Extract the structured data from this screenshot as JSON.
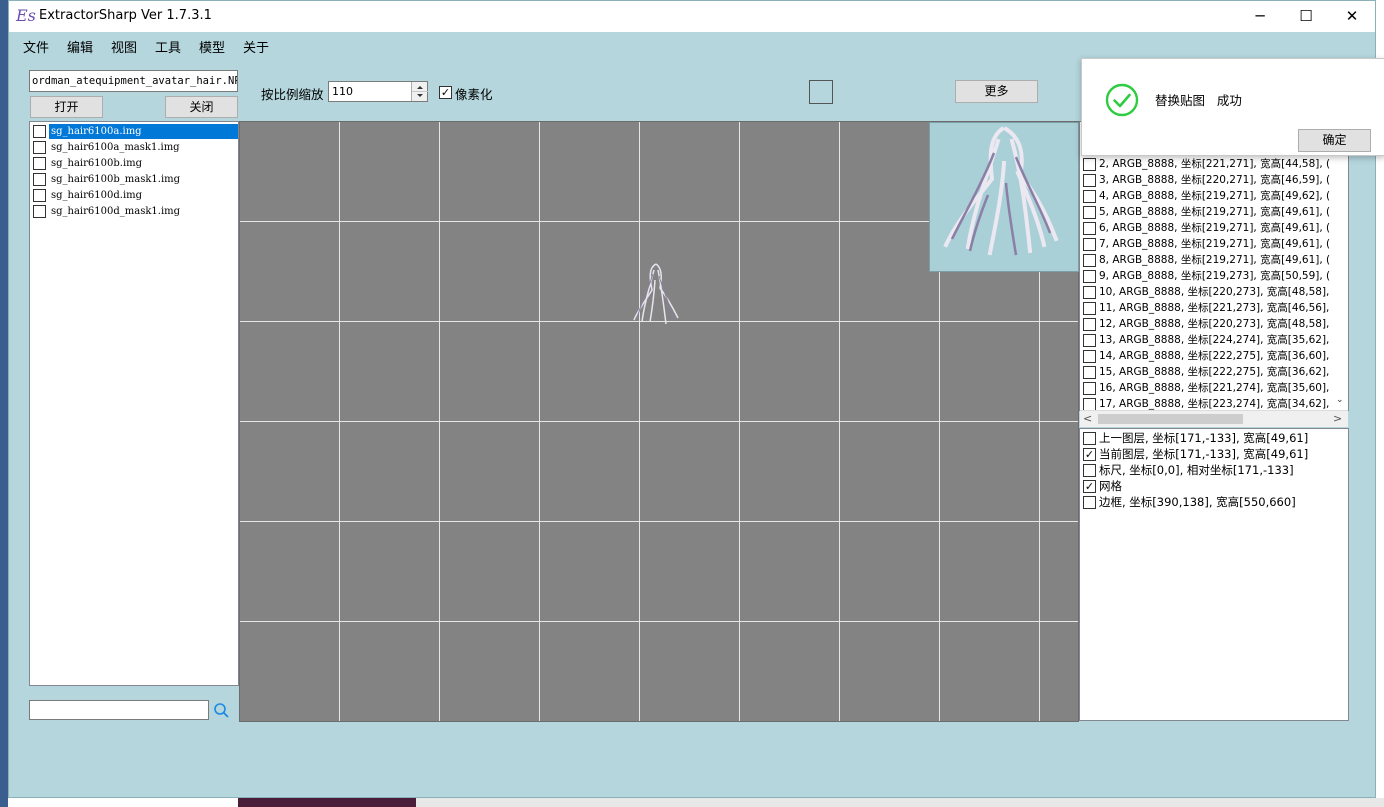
{
  "window": {
    "title": "ExtractorSharp Ver 1.7.3.1",
    "icon_text": "Es",
    "controls": {
      "minimize": "─",
      "maximize": "☐",
      "close": "✕"
    }
  },
  "menu": [
    "文件",
    "编辑",
    "视图",
    "工具",
    "模型",
    "关于"
  ],
  "left_panel": {
    "file_path": "ordman_atequipment_avatar_hair.NPK",
    "open_label": "打开",
    "close_label": "关闭",
    "files": [
      {
        "name": "sg_hair6100a.img",
        "selected": true
      },
      {
        "name": "sg_hair6100a_mask1.img",
        "selected": false
      },
      {
        "name": "sg_hair6100b.img",
        "selected": false
      },
      {
        "name": "sg_hair6100b_mask1.img",
        "selected": false
      },
      {
        "name": "sg_hair6100d.img",
        "selected": false
      },
      {
        "name": "sg_hair6100d_mask1.img",
        "selected": false
      }
    ],
    "search_value": ""
  },
  "toolbar": {
    "zoom_label": "按比例缩放",
    "zoom_value": "110",
    "pixelate_label": "像素化",
    "pixelate_checked": true,
    "more_label": "更多"
  },
  "layers": [
    "2, ARGB_8888, 坐标[221,271], 宽高[44,58], (",
    "3, ARGB_8888, 坐标[220,271], 宽高[46,59], (",
    "4, ARGB_8888, 坐标[219,271], 宽高[49,62], (",
    "5, ARGB_8888, 坐标[219,271], 宽高[49,61], (",
    "6, ARGB_8888, 坐标[219,271], 宽高[49,61], (",
    "7, ARGB_8888, 坐标[219,271], 宽高[49,61], (",
    "8, ARGB_8888, 坐标[219,271], 宽高[49,61], (",
    "9, ARGB_8888, 坐标[219,273], 宽高[50,59], (",
    "10, ARGB_8888, 坐标[220,273], 宽高[48,58],",
    "11, ARGB_8888, 坐标[221,273], 宽高[46,56],",
    "12, ARGB_8888, 坐标[220,273], 宽高[48,58],",
    "13, ARGB_8888, 坐标[224,274], 宽高[35,62],",
    "14, ARGB_8888, 坐标[222,275], 宽高[36,60],",
    "15, ARGB_8888, 坐标[222,275], 宽高[36,62],",
    "16, ARGB_8888, 坐标[221,274], 宽高[35,60],",
    "17, ARGB_8888, 坐标[223,274], 宽高[34,62],"
  ],
  "scroll_glyphs": {
    "left": "<",
    "right": ">",
    "down": "⌄"
  },
  "options": [
    {
      "label": "上一图层, 坐标[171,-133], 宽高[49,61]",
      "checked": false
    },
    {
      "label": "当前图层, 坐标[171,-133], 宽高[49,61]",
      "checked": true
    },
    {
      "label": "标尺, 坐标[0,0], 相对坐标[171,-133]",
      "checked": false
    },
    {
      "label": "网格",
      "checked": true
    },
    {
      "label": "边框, 坐标[390,138], 宽高[550,660]",
      "checked": false
    }
  ],
  "toast": {
    "message": "替换贴图   成功",
    "ok_label": "确定",
    "icon": "check-circle-icon",
    "icon_color": "#2ecc40"
  },
  "colors": {
    "window_bg": "#b5d6dd",
    "canvas_bg": "#838383",
    "selection": "#0078d7"
  }
}
